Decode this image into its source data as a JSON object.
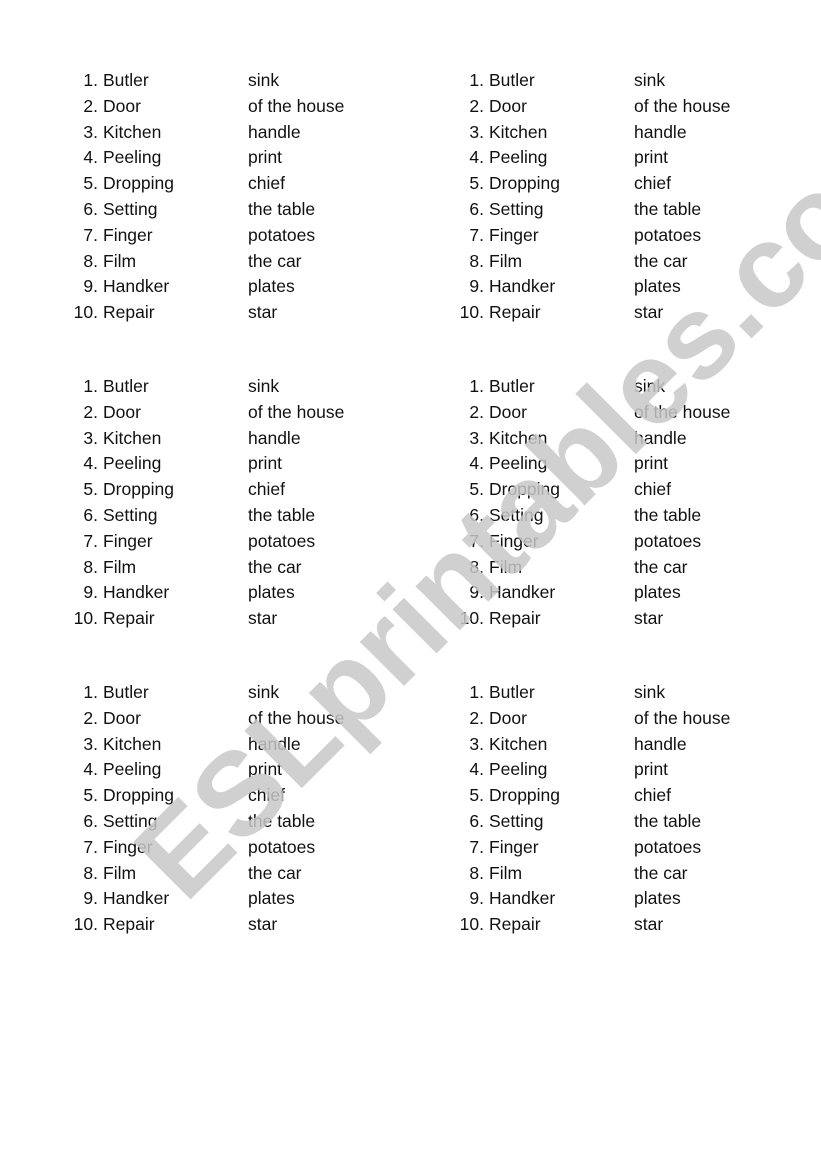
{
  "exercise": {
    "left_words": [
      "Butler",
      "Door",
      "Kitchen",
      "Peeling",
      "Dropping",
      "Setting",
      "Finger",
      "Film",
      "Handker",
      "Repair"
    ],
    "right_words": [
      "sink",
      "of the house",
      "handle",
      "print",
      "chief",
      "the table",
      "potatoes",
      "the car",
      "plates",
      "star"
    ],
    "numbers": [
      "1.",
      "2.",
      "3.",
      "4.",
      "5.",
      "6.",
      "7.",
      "8.",
      "9.",
      "10."
    ]
  },
  "blocks_count": 6,
  "watermark": {
    "text": "ESLprintables.com"
  }
}
